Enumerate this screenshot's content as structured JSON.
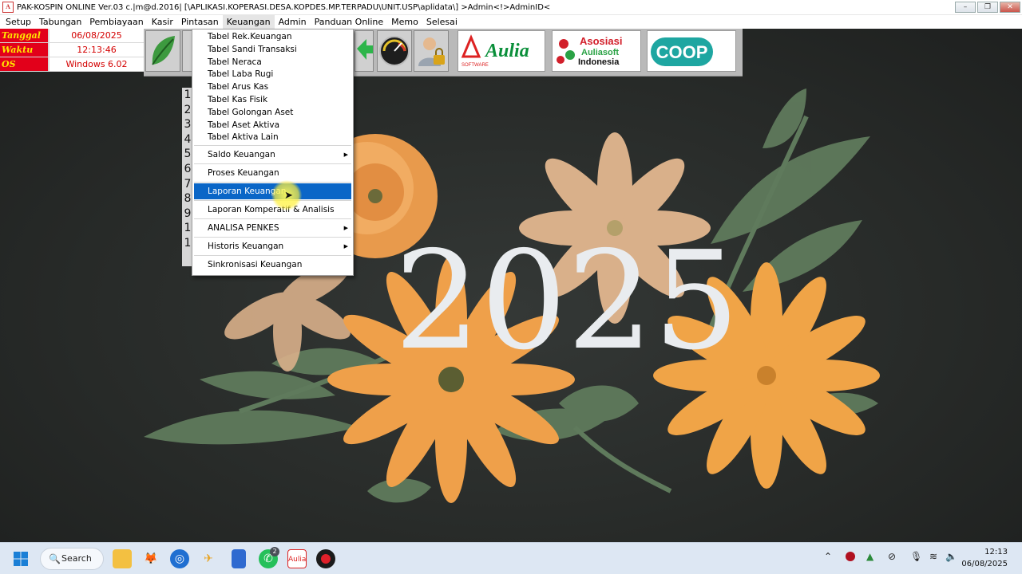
{
  "window": {
    "title": "PAK-KOSPIN ONLINE Ver.03 c.|m@d.2016| [\\APLIKASI.KOPERASI.DESA.KOPDES.MP.TERPADU\\UNIT.USP\\aplidata\\] >Admin<!>AdminID<",
    "app_icon": "Aulia",
    "minimize": "–",
    "restore": "❐",
    "close": "✕"
  },
  "menubar": [
    "Setup",
    "Tabungan",
    "Pembiayaan",
    "Kasir",
    "Pintasan",
    "Keuangan",
    "Admin",
    "Panduan Online",
    "Memo",
    "Selesai"
  ],
  "info": {
    "date_label": "Tanggal",
    "date_value": "06/08/2025",
    "time_label": "Waktu",
    "time_value": "12:13:46",
    "os_label": "OS",
    "os_value": "Windows 6.02"
  },
  "logos": {
    "aulia": "Aulia",
    "software": "SOFTWARE",
    "asosiasi_1": "Asosiasi",
    "asosiasi_2": "Auliasoft",
    "asosiasi_3": "Indonesia",
    "coop": "COOP"
  },
  "side_numbers": [
    "1",
    "2",
    "3",
    "4",
    "5",
    "6",
    "7",
    "8",
    "9",
    "1",
    "1"
  ],
  "dropdown": {
    "group1": [
      "Tabel Rek.Keuangan",
      "Tabel Sandi Transaksi",
      "Tabel Neraca",
      "Tabel Laba Rugi",
      "Tabel Arus Kas",
      "Tabel Kas Fisik",
      "Tabel Golongan Aset",
      "Tabel Aset Aktiva",
      "Tabel Aktiva Lain"
    ],
    "saldo": "Saldo Keuangan",
    "proses": "Proses Keuangan",
    "laporan": "Laporan Keuangan",
    "komperatif": "Laporan Komperatif & Analisis",
    "penkes": "ANALISA PENKES",
    "historis": "Historis Keuangan",
    "sinkron": "Sinkronisasi Keuangan",
    "submenu_arrow": "▶"
  },
  "wallpaper": {
    "year": "2025"
  },
  "taskbar": {
    "search_label": "Search",
    "whatsapp_badge": "2",
    "time": "12:13",
    "date": "06/08/2025"
  },
  "colors": {
    "info_label_bg": "#e2001a",
    "info_label_text": "#ffe600",
    "info_value_text": "#d40000",
    "menu_highlight": "#0a66c7",
    "flower_orange": "#efa04a",
    "flower_beige": "#d9b08a",
    "leaf_green": "#5f7a5c"
  }
}
